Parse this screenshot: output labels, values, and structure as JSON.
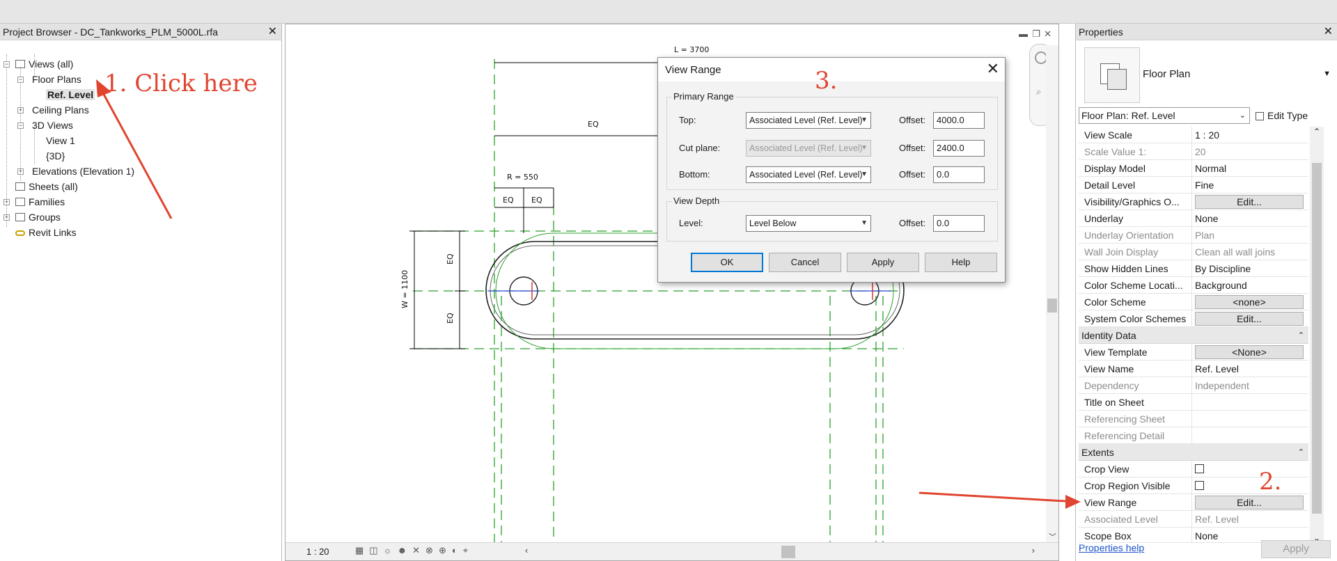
{
  "project_browser": {
    "title": "Project Browser - DC_Tankworks_PLM_5000L.rfa",
    "views_all": "Views (all)",
    "floor_plans": "Floor Plans",
    "ref_level": "Ref. Level",
    "ceiling_plans": "Ceiling Plans",
    "views_3d": "3D Views",
    "view1": "View 1",
    "view_3d": "{3D}",
    "elevations": "Elevations (Elevation 1)",
    "sheets": "Sheets (all)",
    "families": "Families",
    "groups": "Groups",
    "revit_links": "Revit Links"
  },
  "drawing": {
    "length": "L = 3700",
    "eq": "EQ",
    "radius": "R = 550",
    "width": "W = 1100"
  },
  "canvas": {
    "scale": "1 : 20"
  },
  "dialog": {
    "title": "View Range",
    "primary_range": "Primary Range",
    "top_label": "Top:",
    "top_value": "Associated Level (Ref. Level)",
    "top_offset": "4000.0",
    "cut_label": "Cut plane:",
    "cut_value": "Associated Level (Ref. Level)",
    "cut_offset": "2400.0",
    "bottom_label": "Bottom:",
    "bottom_value": "Associated Level (Ref. Level)",
    "bottom_offset": "0.0",
    "view_depth": "View Depth",
    "level_label": "Level:",
    "level_value": "Level Below",
    "level_offset": "0.0",
    "offset_label": "Offset:",
    "ok": "OK",
    "cancel": "Cancel",
    "apply": "Apply",
    "help": "Help"
  },
  "properties": {
    "title": "Properties",
    "type_name": "Floor Plan",
    "instance_selector": "Floor Plan: Ref. Level",
    "edit_type": "Edit Type",
    "rows": {
      "view_scale": {
        "name": "View Scale",
        "value": "1 : 20"
      },
      "scale_value": {
        "name": "Scale Value    1:",
        "value": "20"
      },
      "display_model": {
        "name": "Display Model",
        "value": "Normal"
      },
      "detail_level": {
        "name": "Detail Level",
        "value": "Fine"
      },
      "visibility": {
        "name": "Visibility/Graphics O...",
        "value": "Edit..."
      },
      "underlay": {
        "name": "Underlay",
        "value": "None"
      },
      "underlay_orientation": {
        "name": "Underlay Orientation",
        "value": "Plan"
      },
      "wall_join": {
        "name": "Wall Join Display",
        "value": "Clean all wall joins"
      },
      "hidden_lines": {
        "name": "Show Hidden Lines",
        "value": "By Discipline"
      },
      "color_scheme_location": {
        "name": "Color Scheme Locati...",
        "value": "Background"
      },
      "color_scheme": {
        "name": "Color Scheme",
        "value": "<none>"
      },
      "system_color": {
        "name": "System Color Schemes",
        "value": "Edit..."
      },
      "view_template": {
        "name": "View Template",
        "value": "<None>"
      },
      "view_name": {
        "name": "View Name",
        "value": "Ref. Level"
      },
      "dependency": {
        "name": "Dependency",
        "value": "Independent"
      },
      "title_on_sheet": {
        "name": "Title on Sheet",
        "value": ""
      },
      "ref_sheet": {
        "name": "Referencing Sheet",
        "value": ""
      },
      "ref_detail": {
        "name": "Referencing Detail",
        "value": ""
      },
      "crop_view": {
        "name": "Crop View"
      },
      "crop_region": {
        "name": "Crop Region Visible"
      },
      "view_range": {
        "name": "View Range",
        "value": "Edit..."
      },
      "assoc_level": {
        "name": "Associated Level",
        "value": "Ref. Level"
      },
      "scope_box": {
        "name": "Scope Box",
        "value": "None"
      }
    },
    "identity_data": "Identity Data",
    "extents": "Extents",
    "help_link": "Properties help",
    "apply": "Apply"
  },
  "annotations": {
    "step1": "1. Click here",
    "step2": "2.",
    "step3": "3."
  },
  "colors": {
    "annotation": "#e04530",
    "default_button_border": "#0078d7"
  }
}
